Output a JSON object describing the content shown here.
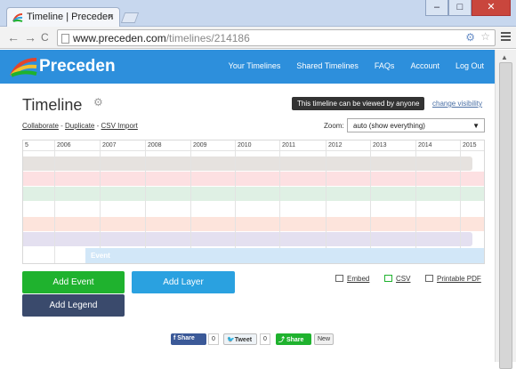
{
  "browser": {
    "tab_title": "Timeline | Preceden",
    "tab_close": "×",
    "url_host": "www.preceden.com",
    "url_path": "/timelines/214186",
    "back": "←",
    "forward": "→",
    "reload": "C",
    "min": "–",
    "max": "□",
    "close": "✕"
  },
  "header": {
    "logo_text": "Preceden",
    "nav": [
      "Your Timelines",
      "Shared Timelines",
      "FAQs",
      "Account",
      "Log Out"
    ]
  },
  "page": {
    "title": "Timeline",
    "visibility_badge": "This timeline can be viewed by anyone",
    "change_visibility": "change visibility",
    "links": {
      "collaborate": "Collaborate",
      "duplicate": "Duplicate",
      "csv_import": "CSV Import",
      "separator": " - "
    },
    "zoom_label": "Zoom:",
    "zoom_value": "auto (show everything)"
  },
  "timeline": {
    "years": [
      "5",
      "2006",
      "2007",
      "2008",
      "2009",
      "2010",
      "2011",
      "2012",
      "2013",
      "2014",
      "2015"
    ],
    "layer_colors": [
      "#e6e2df",
      "#fde0e2",
      "#dff0e4",
      "#ffffff",
      "#fde4dc",
      "#e4e0f0"
    ],
    "event_label": "Event"
  },
  "actions": {
    "add_event": "Add Event",
    "add_layer": "Add Layer",
    "add_legend": "Add Legend",
    "embed": "Embed",
    "csv": "CSV",
    "printable_pdf": "Printable PDF"
  },
  "share": {
    "facebook": "Share",
    "facebook_count": "0",
    "twitter": "Tweet",
    "twitter_count": "0",
    "generic": "Share",
    "new_badge": "New"
  }
}
